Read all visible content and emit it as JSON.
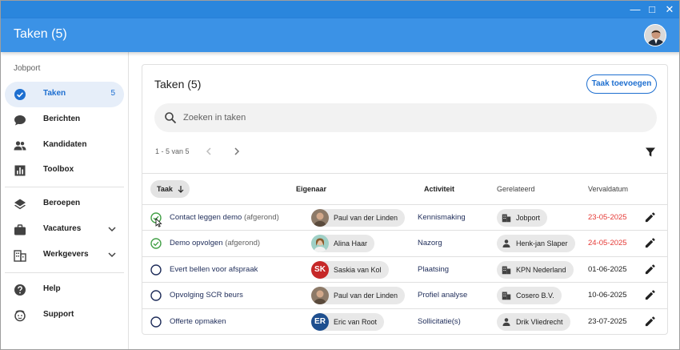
{
  "window": {
    "controls": {
      "minimize": "—",
      "maximize": "□",
      "close": "✕"
    }
  },
  "appbar": {
    "title": "Taken (5)",
    "avatar_icon": "user-avatar-photo"
  },
  "sidebar": {
    "section": "Jobport",
    "items": [
      {
        "label": "Taken",
        "icon": "check-circle-icon",
        "count": "5",
        "active": true
      },
      {
        "label": "Berichten",
        "icon": "chat-bubble-icon"
      },
      {
        "label": "Kandidaten",
        "icon": "people-icon"
      },
      {
        "label": "Toolbox",
        "icon": "bar-chart-icon"
      },
      {
        "label": "Beroepen",
        "icon": "layers-icon"
      },
      {
        "label": "Vacatures",
        "icon": "briefcase-icon",
        "expandable": true
      },
      {
        "label": "Werkgevers",
        "icon": "building-icon",
        "expandable": true
      },
      {
        "label": "Help",
        "icon": "help-icon"
      },
      {
        "label": "Support",
        "icon": "support-icon"
      }
    ]
  },
  "card": {
    "title": "Taken (5)",
    "add_button": "Taak toevoegen",
    "search_placeholder": "Zoeken in taken",
    "pager": "1 - 5 van 5",
    "columns": {
      "task": "Taak",
      "owner": "Eigenaar",
      "activity": "Activiteit",
      "related": "Gerelateerd",
      "due": "Vervaldatum"
    }
  },
  "tasks": [
    {
      "title": "Contact leggen demo",
      "extra": "(afgerond)",
      "done": true,
      "owner": "Paul van der Linden",
      "owner_avatar": "photo",
      "activity": "Kennismaking",
      "related": "Jobport",
      "related_icon": "building-icon",
      "due": "23-05-2025",
      "overdue": true
    },
    {
      "title": "Demo opvolgen",
      "extra": "(afgerond)",
      "done": true,
      "owner": "Alina Haar",
      "owner_avatar": "photo",
      "activity": "Nazorg",
      "related": "Henk-jan Slaper",
      "related_icon": "person-icon",
      "due": "24-05-2025",
      "overdue": true
    },
    {
      "title": "Evert bellen voor afspraak",
      "extra": "",
      "done": false,
      "owner": "Saskia van Kol",
      "owner_avatar": "SK",
      "activity": "Plaatsing",
      "related": "KPN Nederland",
      "related_icon": "building-icon",
      "due": "01-06-2025",
      "overdue": false
    },
    {
      "title": "Opvolging SCR beurs",
      "extra": "",
      "done": false,
      "owner": "Paul van der Linden",
      "owner_avatar": "photo",
      "activity": "Profiel analyse",
      "related": "Cosero B.V.",
      "related_icon": "building-icon",
      "due": "10-06-2025",
      "overdue": false
    },
    {
      "title": "Offerte opmaken",
      "extra": "",
      "done": false,
      "owner": "Eric van Root",
      "owner_avatar": "ER",
      "activity": "Sollicitatie(s)",
      "related": "Drik Vliedrecht",
      "related_icon": "person-icon",
      "due": "23-07-2025",
      "overdue": false
    }
  ],
  "colors": {
    "appbar": "#3b92e6",
    "titlebar": "#2a86dd",
    "accent": "#1e6fd0",
    "done_check": "#43a047",
    "overdue": "#e53935",
    "active_nav": "#e6eef9",
    "avatar_sk": "#c62828",
    "avatar_er": "#1e4f8f"
  }
}
